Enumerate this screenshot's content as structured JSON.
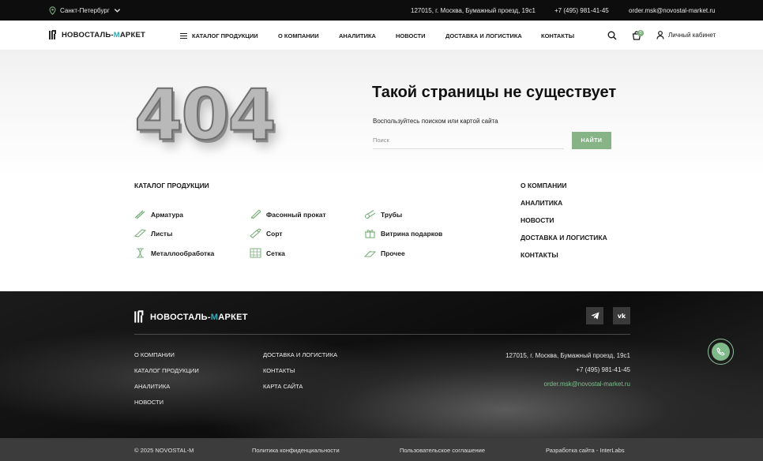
{
  "topbar": {
    "city": "Санкт-Петербург",
    "address": "127015, г. Москва, Бумажный проезд, 19с1",
    "phone": "+7 (495) 981-41-45",
    "email": "order.msk@novostal-market.ru"
  },
  "header": {
    "logo_main": "НОВОСТАЛЬ-",
    "logo_accent": "М",
    "logo_rest": "АРКЕТ",
    "nav": [
      "КАТАЛОГ ПРОДУКЦИИ",
      "О КОМПАНИИ",
      "АНАЛИТИКА",
      "НОВОСТИ",
      "ДОСТАВКА И ЛОГИСТИКА",
      "КОНТАКТЫ"
    ],
    "cart_count": "0",
    "account_label": "Личный кабинет"
  },
  "hero": {
    "code": "404",
    "title": "Такой страницы не существует",
    "hint": "Воспользуйтесь поиском или картой сайта",
    "search_placeholder": "Поиск",
    "search_button": "НАЙТИ"
  },
  "catalog": {
    "title": "КАТАЛОГ ПРОДУКЦИИ",
    "items": [
      "Арматура",
      "Фасонный прокат",
      "Трубы",
      "Листы",
      "Сорт",
      "Витрина подарков",
      "Металлообработка",
      "Сетка",
      "Прочее"
    ]
  },
  "right_nav": [
    "О КОМПАНИИ",
    "АНАЛИТИКА",
    "НОВОСТИ",
    "ДОСТАВКА И ЛОГИСТИКА",
    "КОНТАКТЫ"
  ],
  "footer": {
    "logo_main": "НОВОСТАЛЬ-",
    "logo_accent": "М",
    "logo_rest": "АРКЕТ",
    "social": [
      "telegram",
      "vk"
    ],
    "col1": [
      "О КОМПАНИИ",
      "КАТАЛОГ ПРОДУКЦИИ",
      "АНАЛИТИКА",
      "НОВОСТИ"
    ],
    "col2": [
      "ДОСТАВКА И ЛОГИСТИКА",
      "КОНТАКТЫ",
      "КАРТА САЙТА"
    ],
    "address": "127015, г. Москва, Бумажный проезд, 19с1",
    "phone": "+7 (495) 981-41-45",
    "email": "order.msk@novostal-market.ru"
  },
  "bottombar": {
    "copyright": "© 2025 NOVOSTAL-M",
    "privacy": "Политика конфиденциальности",
    "agreement": "Пользовательское соглашение",
    "dev": "Разработка сайта - InterLabs"
  },
  "colors": {
    "accent_green": "#86b487",
    "logo_accent": "#3aa6b0",
    "topbar_bg": "#0d0d0d"
  }
}
